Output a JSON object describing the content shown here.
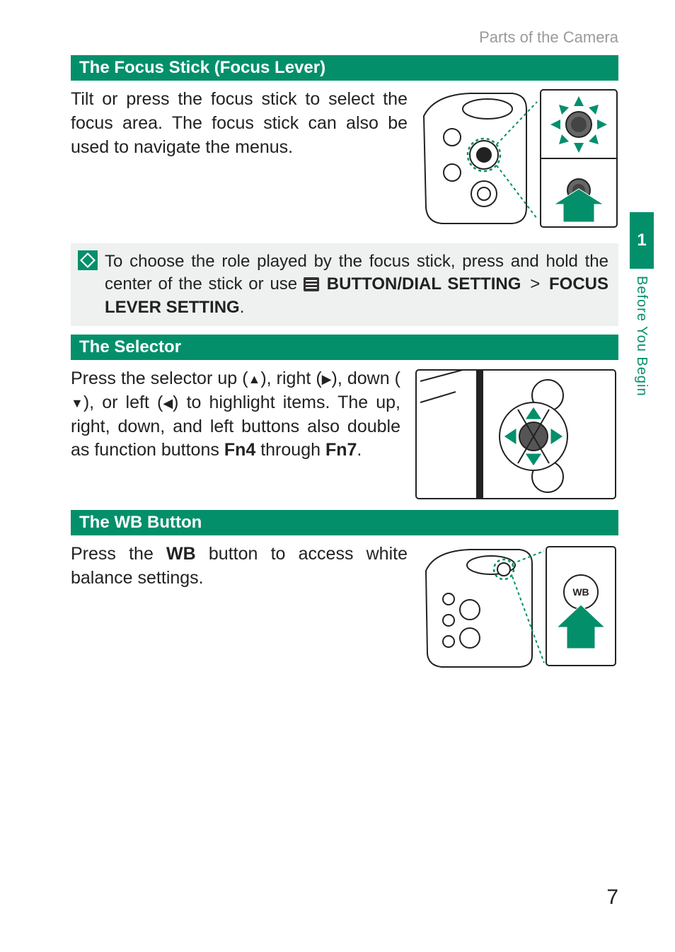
{
  "breadcrumb": "Parts of the Camera",
  "chapter_tab": "1",
  "chapter_side_text": "Before You Begin",
  "page_number": "7",
  "sections": {
    "focus_stick": {
      "heading": "The Focus Stick (Focus Lever)",
      "body_pre": "Tilt or press the focus stick to select the focus area. The focus stick can also be used to navigate the menus.",
      "note_pre": "To choose the role played by the focus stick, press and hold the center of the stick or use ",
      "note_menu1": "BUTTON/DIAL SETTING",
      "note_gt": ">",
      "note_menu2": "FOCUS LEVER SETTING",
      "note_post": "."
    },
    "selector": {
      "heading": "The Selector",
      "body_pre": "Press the selector up (",
      "body_mid1": "), right (",
      "body_mid2": "), down (",
      "body_mid3": "), or left (",
      "body_mid4": ") to highlight items. The up, right, down, and left buttons also double as function buttons ",
      "fn4": "Fn4",
      "body_mid5": " through ",
      "fn7": "Fn7",
      "body_post": "."
    },
    "wb": {
      "heading": "The WB Button",
      "body_pre": "Press the ",
      "wb_bold": "WB",
      "body_post": " button to access white balance settings."
    }
  },
  "icons": {
    "tri_up": "▲",
    "tri_right": "▶",
    "tri_down": "▼",
    "tri_left": "◀"
  }
}
